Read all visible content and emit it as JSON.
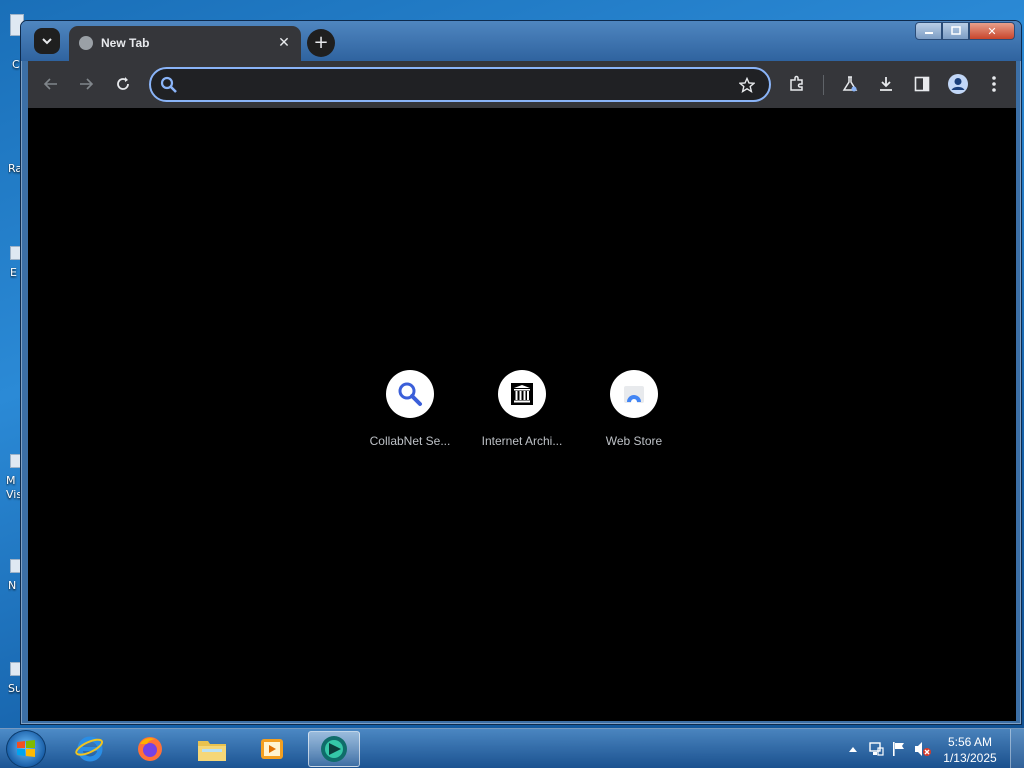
{
  "desktop": {
    "icon_labels": [
      "C",
      "Ra",
      "E",
      "M\nVis",
      "N",
      "Su"
    ]
  },
  "browser": {
    "tab": {
      "title": "New Tab"
    },
    "omnibox": {
      "value": "",
      "placeholder": ""
    },
    "shortcuts": [
      {
        "name": "CollabNet Se...",
        "icon": "search-icon"
      },
      {
        "name": "Internet Archi...",
        "icon": "archive-icon"
      },
      {
        "name": "Web Store",
        "icon": "webstore-icon"
      }
    ]
  },
  "taskbar": {
    "apps": [
      "internet-explorer",
      "firefox",
      "file-explorer",
      "media-player",
      "browser"
    ],
    "clock": {
      "time": "5:56 AM",
      "date": "1/13/2025"
    }
  }
}
